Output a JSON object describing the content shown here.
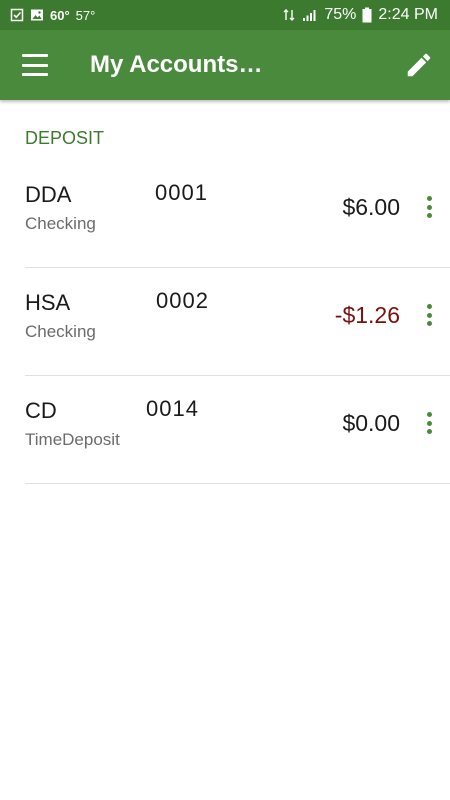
{
  "status_bar": {
    "temp_high": "60°",
    "temp_current": "57°",
    "battery_percent": "75%",
    "time": "2:24 PM"
  },
  "app_bar": {
    "title": "My Accounts…"
  },
  "section": {
    "header": "DEPOSIT"
  },
  "accounts": [
    {
      "name": "DDA",
      "number": "0001",
      "type": "Checking",
      "balance": "$6.00",
      "negative": false
    },
    {
      "name": "HSA",
      "number": "0002",
      "type": "Checking",
      "balance": "-$1.26",
      "negative": true
    },
    {
      "name": "CD",
      "number": "0014",
      "type": "TimeDeposit",
      "balance": "$0.00",
      "negative": false
    }
  ],
  "colors": {
    "status_bar": "#3c7a2f",
    "app_bar": "#4a8a3c",
    "section_header": "#3c7a2f",
    "negative_balance": "#7a0f0f"
  }
}
